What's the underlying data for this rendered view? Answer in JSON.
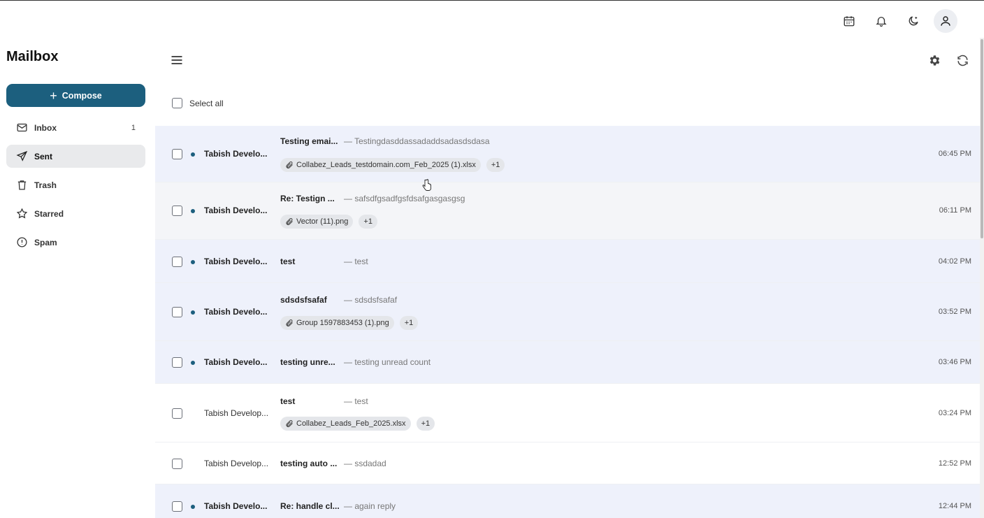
{
  "header": {
    "icons": [
      "calendar-icon",
      "bell-icon",
      "moon-icon",
      "user-icon"
    ]
  },
  "sidebar": {
    "title": "Mailbox",
    "compose_label": "Compose",
    "items": [
      {
        "label": "Inbox",
        "icon": "mail-icon",
        "count": "1",
        "active": false
      },
      {
        "label": "Sent",
        "icon": "send-icon",
        "count": "",
        "active": true
      },
      {
        "label": "Trash",
        "icon": "trash-icon",
        "count": "",
        "active": false
      },
      {
        "label": "Starred",
        "icon": "star-icon",
        "count": "",
        "active": false
      },
      {
        "label": "Spam",
        "icon": "alert-icon",
        "count": "",
        "active": false
      }
    ]
  },
  "toolbar": {
    "select_all_label": "Select all",
    "icons": [
      "menu-icon",
      "settings-icon",
      "refresh-icon"
    ]
  },
  "emails": [
    {
      "sender": "Tabish Develo...",
      "subject": "Testing emai...",
      "snippet": "— Testingdasddassadaddsadasdsdasa",
      "time": "06:45 PM",
      "unread": true,
      "attachments": [
        "Collabez_Leads_testdomain.com_Feb_2025 (1).xlsx",
        "+1"
      ]
    },
    {
      "sender": "Tabish Develo...",
      "subject": "Re: Testign ...",
      "snippet": "— safsdfgsadfgsfdsafgasgasgsg",
      "time": "06:11 PM",
      "unread": true,
      "attachments": [
        "Vector (11).png",
        "+1"
      ]
    },
    {
      "sender": "Tabish Develo...",
      "subject": "test",
      "snippet": "— test",
      "time": "04:02 PM",
      "unread": true,
      "attachments": []
    },
    {
      "sender": "Tabish Develo...",
      "subject": "sdsdsfsafaf",
      "snippet": "— sdsdsfsafaf",
      "time": "03:52 PM",
      "unread": true,
      "attachments": [
        "Group 1597883453 (1).png",
        "+1"
      ]
    },
    {
      "sender": "Tabish Develo...",
      "subject": "testing unre...",
      "snippet": "— testing unread count",
      "time": "03:46 PM",
      "unread": true,
      "attachments": []
    },
    {
      "sender": "Tabish Develop...",
      "subject": "test",
      "snippet": "— test",
      "time": "03:24 PM",
      "unread": false,
      "attachments": [
        "Collabez_Leads_Feb_2025.xlsx",
        "+1"
      ]
    },
    {
      "sender": "Tabish Develop...",
      "subject": "testing auto ...",
      "snippet": "— ssdadad",
      "time": "12:52 PM",
      "unread": false,
      "attachments": []
    },
    {
      "sender": "Tabish Develo...",
      "subject": "Re: handle cl...",
      "snippet": "— again reply",
      "time": "12:44 PM",
      "unread": true,
      "attachments": []
    }
  ],
  "colors": {
    "accent": "#1c5f7e",
    "unread_row": "#eef1fb",
    "active_nav": "#e9eaec"
  }
}
